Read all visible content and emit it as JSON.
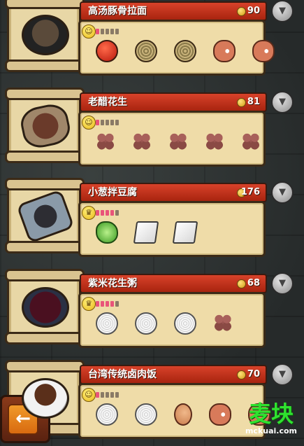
{
  "recipes": [
    {
      "title": "高汤豚骨拉面",
      "price": "90",
      "dish_type": "bowl",
      "mood_icon": "smile-face-icon",
      "mood_glyph": "☺",
      "pips": [
        true,
        false,
        false,
        false,
        false
      ],
      "ingredients": [
        "tomato",
        "noodle",
        "noodle",
        "ham",
        "ham"
      ]
    },
    {
      "title": "老醋花生",
      "price": "81",
      "dish_type": "plate",
      "mood_icon": "smile-face-icon",
      "mood_glyph": "☺",
      "pips": [
        true,
        false,
        false,
        false,
        false
      ],
      "ingredients": [
        "peanut",
        "peanut",
        "peanut",
        "peanut",
        "peanut"
      ]
    },
    {
      "title": "小葱拌豆腐",
      "price": "176",
      "dish_type": "tray",
      "mood_icon": "crown-face-icon",
      "mood_glyph": "♛",
      "pips": [
        true,
        true,
        true,
        true,
        false
      ],
      "ingredients": [
        "lettuce",
        "tofu",
        "tofu"
      ]
    },
    {
      "title": "紫米花生粥",
      "price": "68",
      "dish_type": "purple",
      "mood_icon": "crown-face-icon",
      "mood_glyph": "♛",
      "pips": [
        true,
        true,
        true,
        true,
        false
      ],
      "ingredients": [
        "ricebowl",
        "ricebowl",
        "ricebowl",
        "peanut"
      ]
    },
    {
      "title": "台湾传统卤肉饭",
      "price": "70",
      "dish_type": "rice",
      "mood_icon": "smile-face-icon",
      "mood_glyph": "☺",
      "pips": [
        true,
        false,
        false,
        false,
        false
      ],
      "ingredients": [
        "ricebowl",
        "ricebowl",
        "drumstick",
        "ham",
        "ham"
      ]
    }
  ],
  "dropdown_glyph": "▼",
  "back_glyph": "←",
  "watermark": {
    "main": "麦块",
    "sub": "mckuai.com"
  }
}
